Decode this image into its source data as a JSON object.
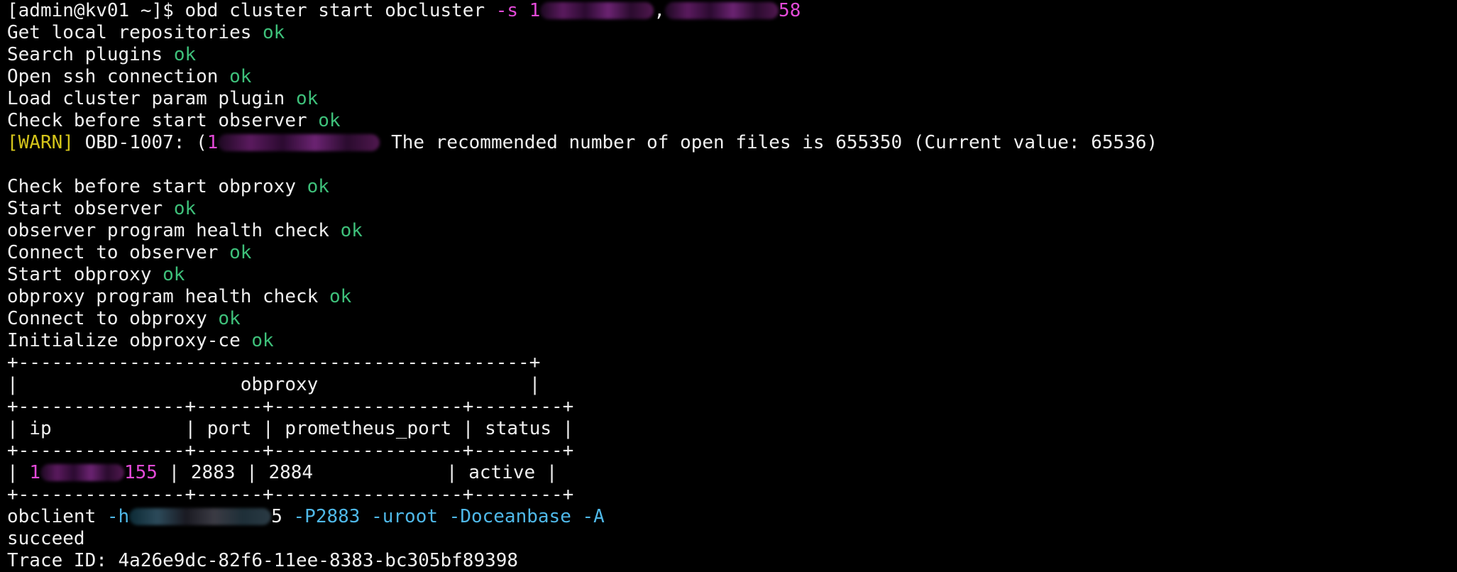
{
  "command": {
    "prompt": "[admin@kv01 ~]$",
    "text": "obd cluster start obcluster",
    "flag": "-s",
    "ip1_visible_start": "1",
    "separator": ",",
    "ip2_visible_end": "58"
  },
  "steps_a": [
    {
      "text": "Get local repositories",
      "status": "ok"
    },
    {
      "text": "Search plugins",
      "status": "ok"
    },
    {
      "text": "Open ssh connection",
      "status": "ok"
    },
    {
      "text": "Load cluster param plugin",
      "status": "ok"
    },
    {
      "text": "Check before start observer",
      "status": "ok"
    }
  ],
  "warning": {
    "tag": "[WARN]",
    "code": "OBD-1007: (",
    "ip_visible_start": "1",
    "message": "The recommended number of open files is 655350 (Current value: 65536)"
  },
  "steps_b": [
    {
      "text": "Check before start obproxy",
      "status": "ok"
    },
    {
      "text": "Start observer",
      "status": "ok"
    },
    {
      "text": "observer program health check",
      "status": "ok"
    },
    {
      "text": "Connect to observer",
      "status": "ok"
    },
    {
      "text": "Start obproxy",
      "status": "ok"
    },
    {
      "text": "obproxy program health check",
      "status": "ok"
    },
    {
      "text": "Connect to obproxy",
      "status": "ok"
    },
    {
      "text": "Initialize obproxy-ce",
      "status": "ok"
    }
  ],
  "table": {
    "border_top": "+----------------------------------------------+",
    "title_row": "|                    obproxy                   |",
    "border_mid": "+---------------+------+-----------------+--------+",
    "header_row": "| ip            | port | prometheus_port | status |",
    "row": {
      "prefix": "| ",
      "ip_visible_start": "1",
      "ip_visible_end": "155",
      "rest": " | 2883 | 2884            | active |"
    },
    "border_bottom": "+---------------+------+-----------------+--------+"
  },
  "client": {
    "cmd": "obclient",
    "host_flag_start": "-h",
    "host_visible_end": "5",
    "args": "-P2883 -uroot -Doceanbase -A"
  },
  "result": "succeed",
  "trace": "Trace ID: 4a26e9dc-82f6-11ee-8383-bc305bf89398"
}
